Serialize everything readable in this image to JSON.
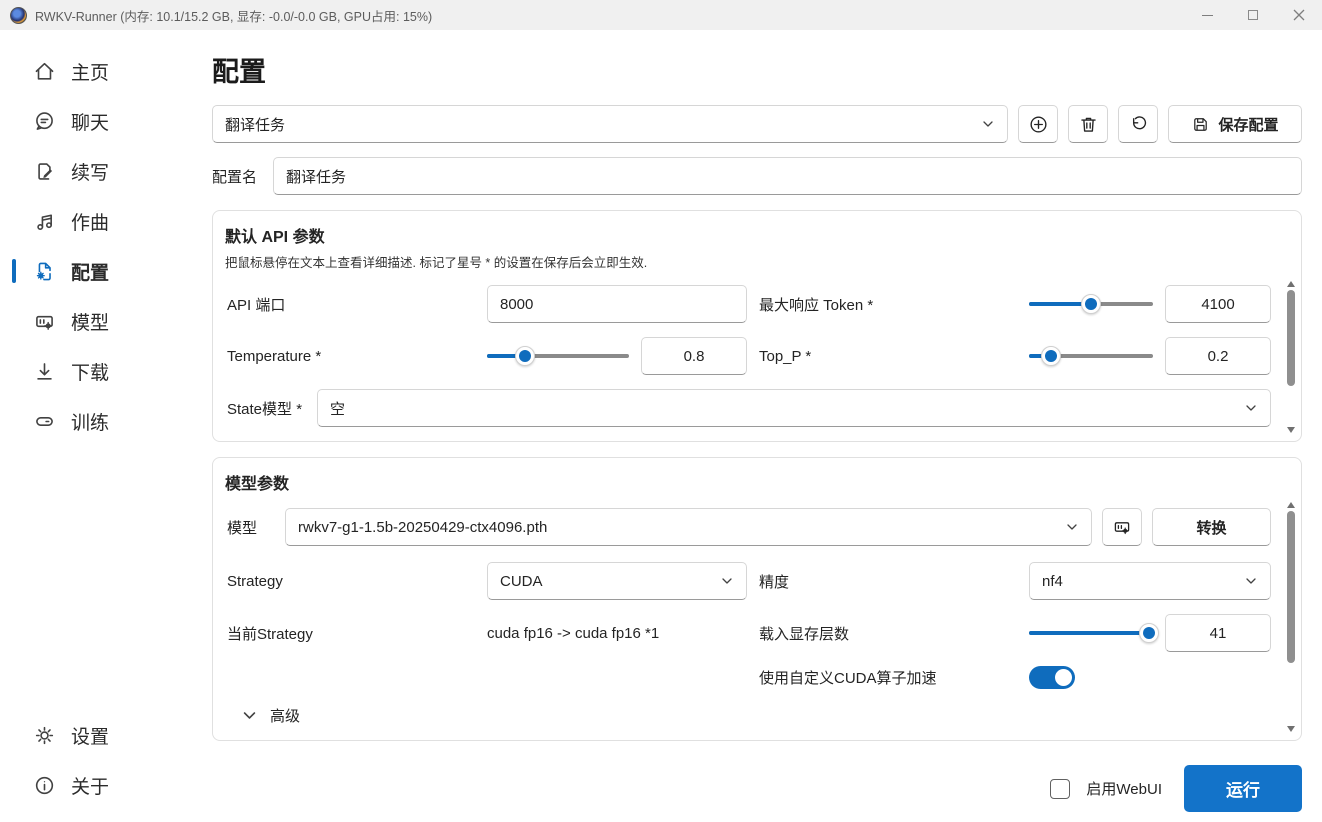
{
  "titlebar": {
    "title": "RWKV-Runner (内存: 10.1/15.2 GB, 显存: -0.0/-0.0 GB, GPU占用: 15%)"
  },
  "sidebar": {
    "items": [
      {
        "label": "主页",
        "icon": "home-icon"
      },
      {
        "label": "聊天",
        "icon": "chat-icon"
      },
      {
        "label": "续写",
        "icon": "compose-icon"
      },
      {
        "label": "作曲",
        "icon": "music-icon"
      },
      {
        "label": "配置",
        "icon": "config-icon",
        "selected": true
      },
      {
        "label": "模型",
        "icon": "models-icon"
      },
      {
        "label": "下载",
        "icon": "download-icon"
      },
      {
        "label": "训练",
        "icon": "train-icon"
      }
    ],
    "bottom_items": [
      {
        "label": "设置",
        "icon": "settings-icon"
      },
      {
        "label": "关于",
        "icon": "about-icon"
      }
    ]
  },
  "page_title": "配置",
  "toolbar": {
    "preset_value": "翻译任务",
    "add_icon": "plus-circle-icon",
    "delete_icon": "trash-icon",
    "reset_icon": "undo-icon",
    "save_icon": "save-icon",
    "save_label": "保存配置"
  },
  "config_name": {
    "label": "配置名",
    "value": "翻译任务"
  },
  "api_section": {
    "title": "默认 API 参数",
    "subtitle": "把鼠标悬停在文本上查看详细描述. 标记了星号 * 的设置在保存后会立即生效.",
    "port": {
      "label": "API 端口",
      "value": "8000"
    },
    "max_token": {
      "label": "最大响应 Token *",
      "value": "4100",
      "percent": 50
    },
    "temperature": {
      "label": "Temperature *",
      "value": "0.8",
      "percent": 27
    },
    "top_p": {
      "label": "Top_P *",
      "value": "0.2",
      "percent": 18
    },
    "state_model": {
      "label": "State模型 *",
      "value": "空"
    }
  },
  "model_section": {
    "title": "模型参数",
    "model": {
      "label": "模型",
      "value": "rwkv7-g1-1.5b-20250429-ctx4096.pth",
      "manage_icon": "model-manage-icon",
      "convert_label": "转换"
    },
    "strategy": {
      "label": "Strategy",
      "value": "CUDA"
    },
    "precision": {
      "label": "精度",
      "value": "nf4"
    },
    "current_strategy": {
      "label": "当前Strategy",
      "value": "cuda fp16 -> cuda fp16 *1"
    },
    "gpu_layers": {
      "label": "载入显存层数",
      "value": "41",
      "percent": 97
    },
    "custom_cuda": {
      "label": "使用自定义CUDA算子加速",
      "enabled": true
    },
    "advanced_label": "高级"
  },
  "footer": {
    "webui_label": "启用WebUI",
    "webui_checked": false,
    "run_label": "运行"
  },
  "colors": {
    "accent": "#0f6cbd",
    "run_button": "#1373c9",
    "titlebar_bg": "#f0f0f0"
  }
}
